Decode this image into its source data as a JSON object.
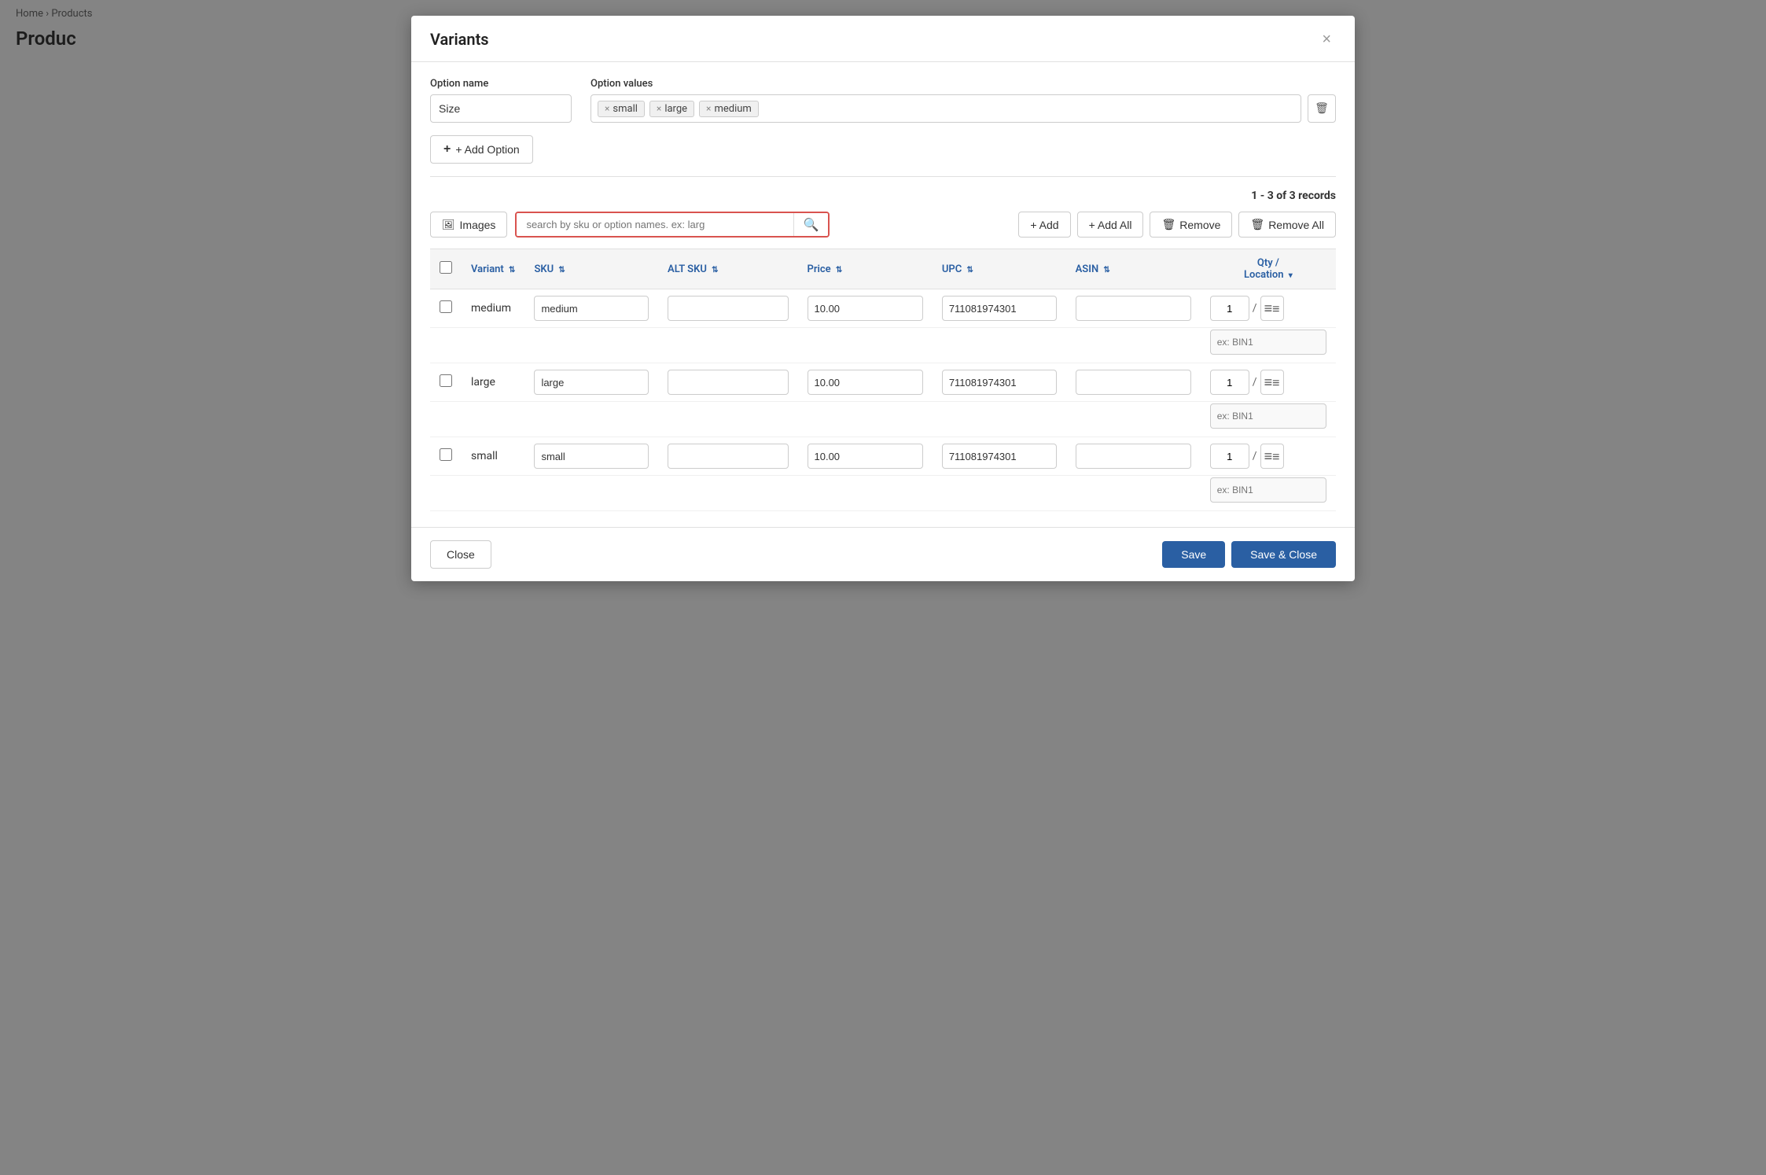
{
  "background": {
    "breadcrumb": "Home › Products",
    "title": "Produc"
  },
  "modal": {
    "title": "Variants",
    "close_label": "×",
    "option_name_label": "Option name",
    "option_name_value": "Size",
    "option_values_label": "Option values",
    "option_values": [
      {
        "label": "small"
      },
      {
        "label": "large"
      },
      {
        "label": "medium"
      }
    ],
    "add_option_label": "+ Add Option",
    "records_info": "1 - 3 of 3 records",
    "images_btn_label": "Images",
    "search_placeholder": "search by sku or option names. ex: larg",
    "btn_add_label": "+ Add",
    "btn_add_all_label": "+ Add All",
    "btn_remove_label": "Remove",
    "btn_remove_all_label": "Remove All",
    "table": {
      "columns": [
        {
          "key": "variant",
          "label": "Variant",
          "sortable": true
        },
        {
          "key": "sku",
          "label": "SKU",
          "sortable": true
        },
        {
          "key": "alt_sku",
          "label": "ALT SKU",
          "sortable": true
        },
        {
          "key": "price",
          "label": "Price",
          "sortable": true
        },
        {
          "key": "upc",
          "label": "UPC",
          "sortable": true
        },
        {
          "key": "asin",
          "label": "ASIN",
          "sortable": true
        },
        {
          "key": "qty_location",
          "label": "Qty / Location",
          "sortable": true
        }
      ],
      "rows": [
        {
          "variant": "medium",
          "sku_value": "medium",
          "alt_sku_value": "",
          "price_value": "10.00",
          "upc_value": "711081974301",
          "asin_value": "",
          "qty": "1",
          "bin_placeholder": "ex: BIN1"
        },
        {
          "variant": "large",
          "sku_value": "large",
          "alt_sku_value": "",
          "price_value": "10.00",
          "upc_value": "711081974301",
          "asin_value": "",
          "qty": "1",
          "bin_placeholder": "ex: BIN1"
        },
        {
          "variant": "small",
          "sku_value": "small",
          "alt_sku_value": "",
          "price_value": "10.00",
          "upc_value": "711081974301",
          "asin_value": "",
          "qty": "1",
          "bin_placeholder": "ex: BIN1"
        }
      ]
    },
    "footer": {
      "close_label": "Close",
      "save_label": "Save",
      "save_close_label": "Save & Close"
    }
  }
}
